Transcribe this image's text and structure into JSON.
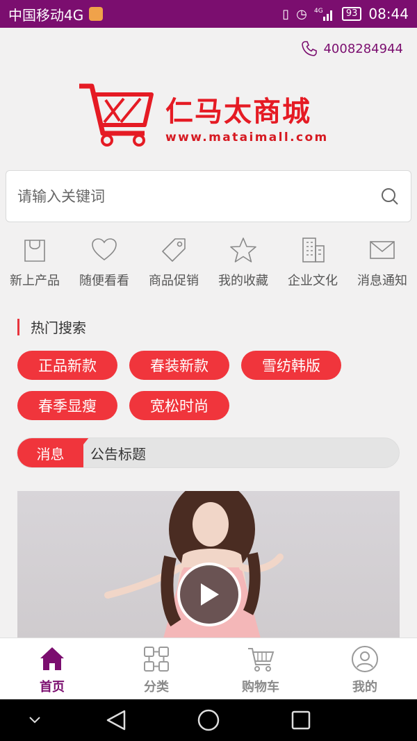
{
  "status_bar": {
    "carrier": "中国移动4G",
    "battery": "93",
    "time": "08:44"
  },
  "header": {
    "phone": "4008284944"
  },
  "logo": {
    "title": "仁马太商城",
    "url": "www.mataimall.com"
  },
  "search": {
    "placeholder": "请输入关键词"
  },
  "quick_nav": [
    {
      "label": "新上产品",
      "icon": "shopping-bag-icon"
    },
    {
      "label": "随便看看",
      "icon": "heart-icon"
    },
    {
      "label": "商品促销",
      "icon": "tag-icon"
    },
    {
      "label": "我的收藏",
      "icon": "star-icon"
    },
    {
      "label": "企业文化",
      "icon": "building-icon"
    },
    {
      "label": "消息通知",
      "icon": "envelope-icon"
    }
  ],
  "hot_search": {
    "title": "热门搜索",
    "tags": [
      "正品新款",
      "春装新款",
      "雪纺韩版",
      "春季显瘦",
      "宽松时尚"
    ]
  },
  "notice": {
    "label": "消息",
    "text": "公告标题"
  },
  "tab_bar": [
    {
      "label": "首页",
      "icon": "home-icon",
      "active": true
    },
    {
      "label": "分类",
      "icon": "category-icon",
      "active": false
    },
    {
      "label": "购物车",
      "icon": "cart-icon",
      "active": false
    },
    {
      "label": "我的",
      "icon": "user-icon",
      "active": false
    }
  ],
  "colors": {
    "brand_purple": "#7b0e6f",
    "accent_red": "#f0353c",
    "logo_red": "#e51b24"
  }
}
